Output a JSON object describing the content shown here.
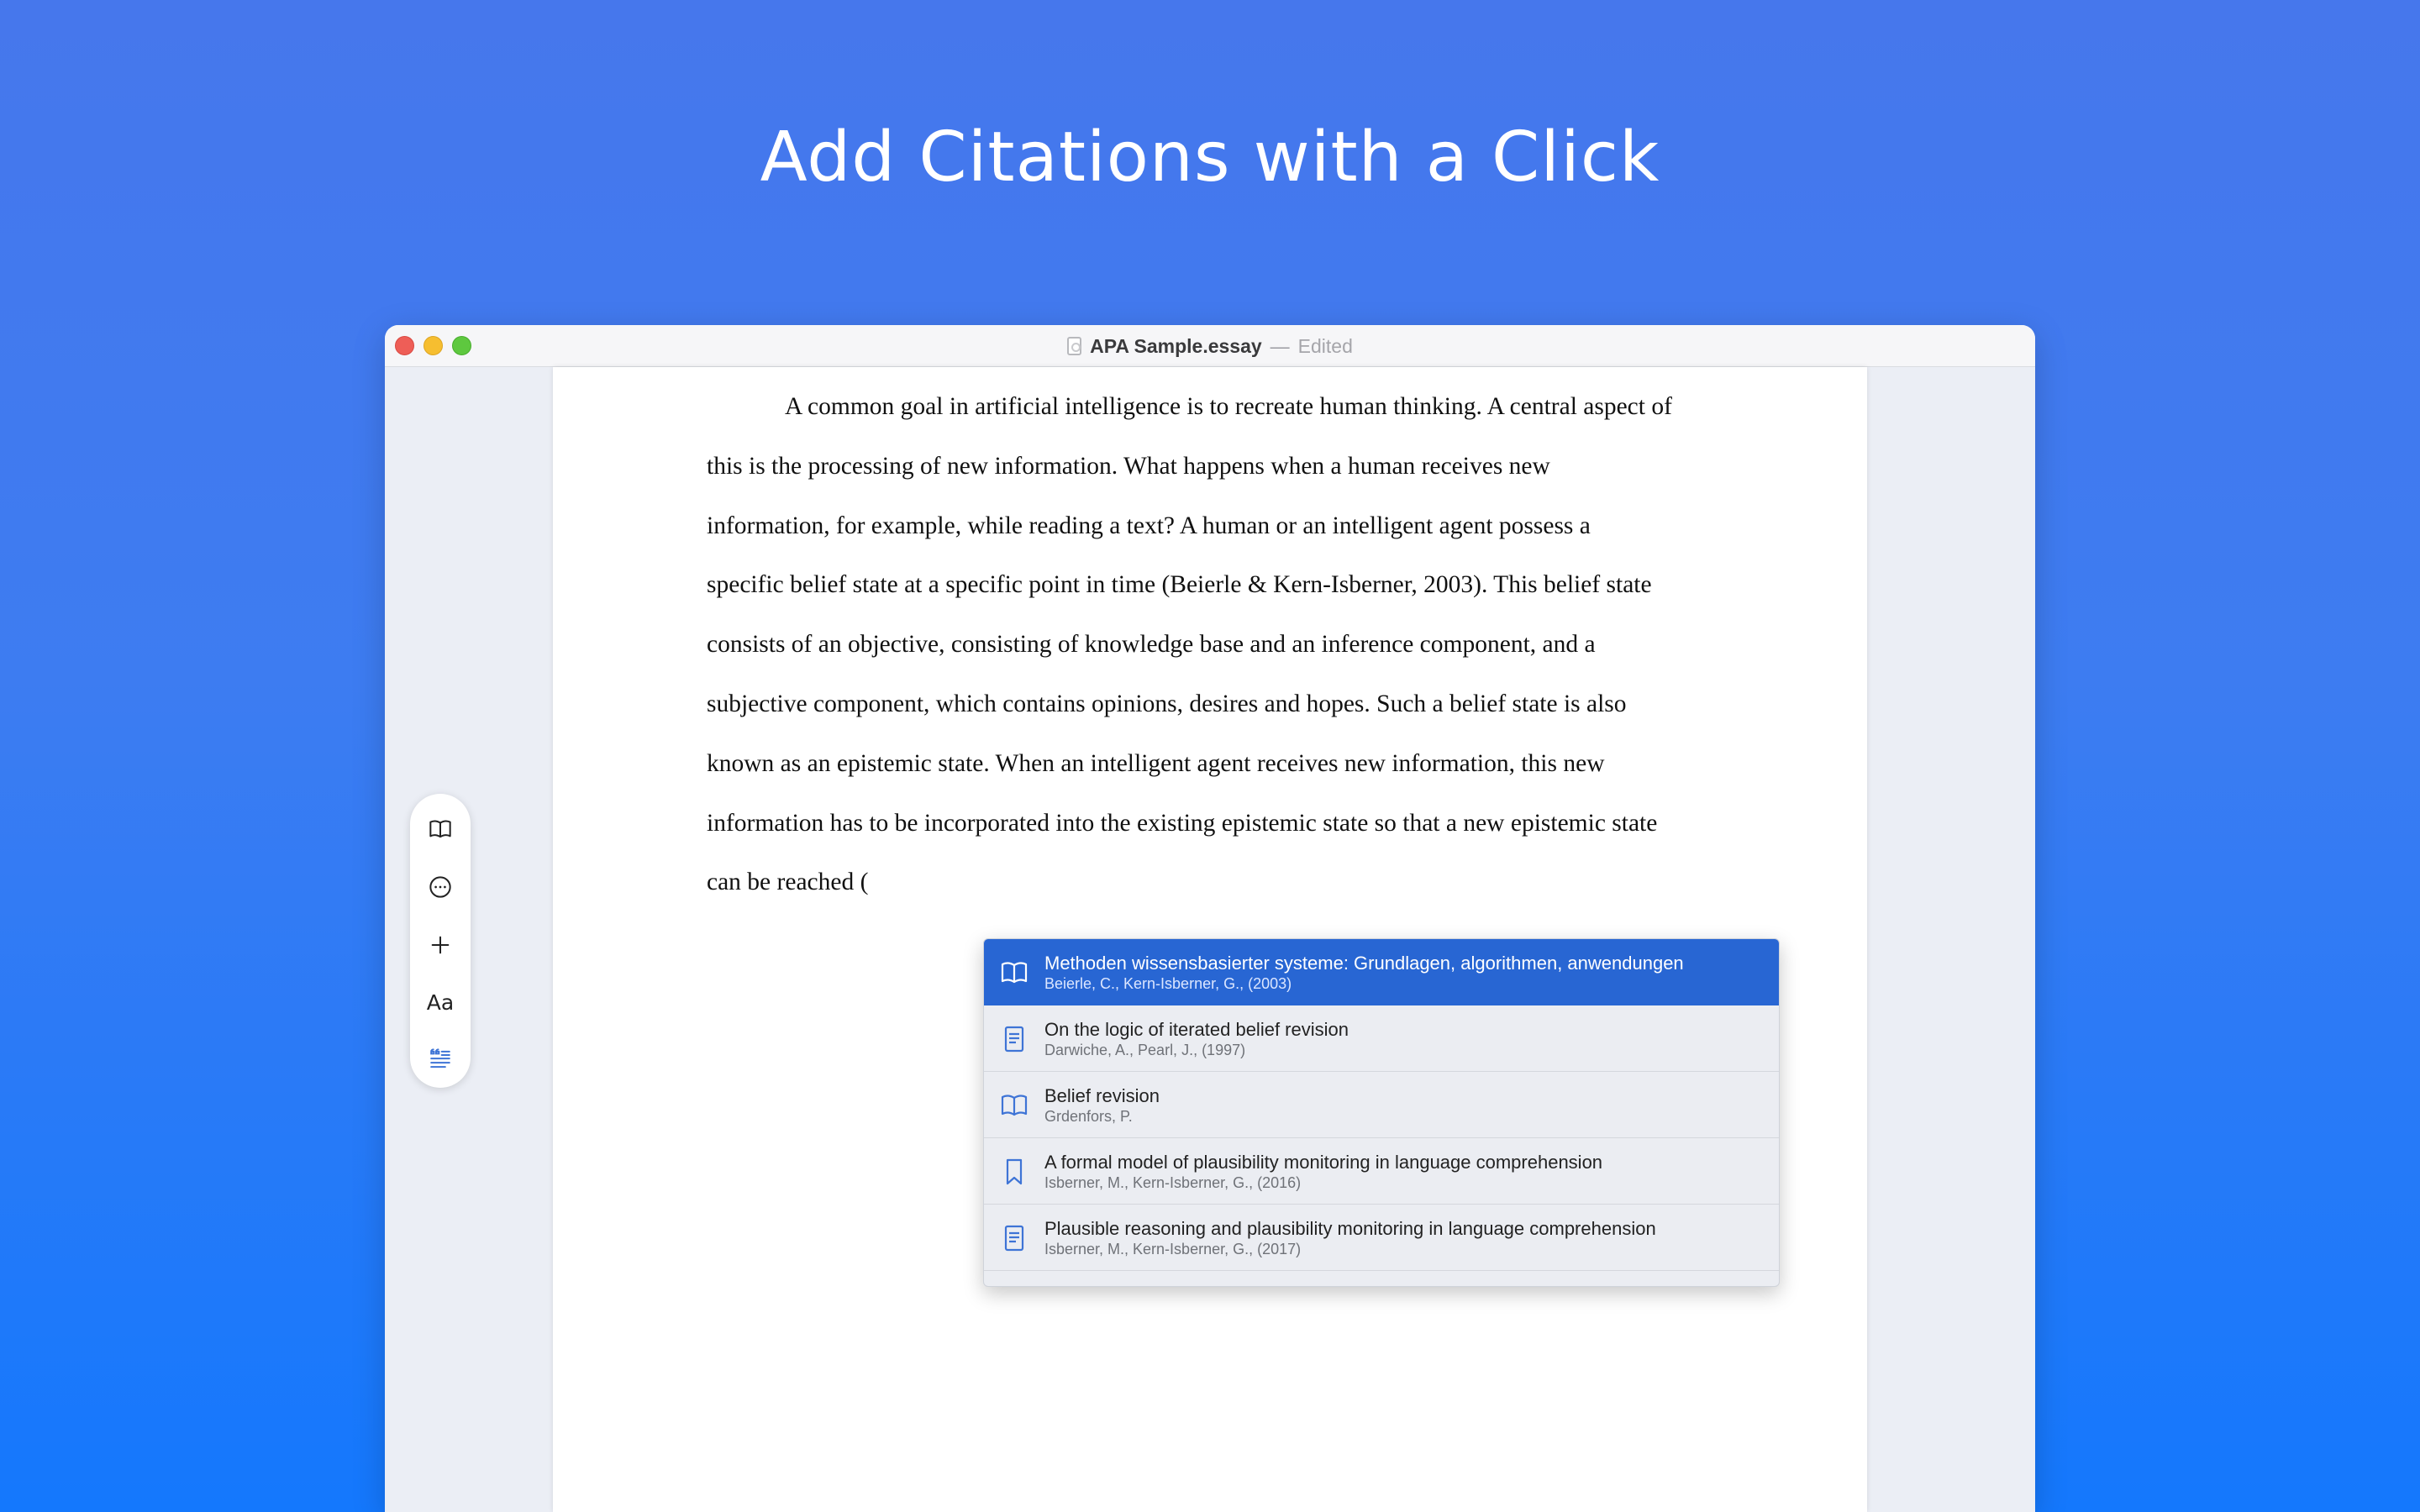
{
  "headline": "Add Citations with a Click",
  "window": {
    "title": "APA Sample.essay",
    "separator": "—",
    "status": "Edited"
  },
  "essay_lines": [
    "A common goal in artificial intelligence is to recreate human thinking. A central aspect of",
    "this is the processing of new information. What happens when a human receives new",
    "information, for example, while reading a text? A human or an intelligent agent possess a",
    "specific belief state at a specific point in time (Beierle & Kern-Isberner, 2003). This belief state",
    "consists of an objective, consisting of knowledge base and an inference component, and a",
    "subjective component, which contains opinions, desires and hopes. Such a belief state is also",
    "known as an epistemic state. When an intelligent agent receives new information, this new",
    "information has to be incorporated into the existing epistemic state so that a new epistemic state",
    "can be reached ("
  ],
  "toolbar": {
    "items": [
      {
        "icon": "book-icon"
      },
      {
        "icon": "more-circle-icon"
      },
      {
        "icon": "plus-icon"
      },
      {
        "icon": "font-icon",
        "label": "Aa"
      },
      {
        "icon": "citation-icon"
      }
    ]
  },
  "citations": [
    {
      "icon": "book-icon",
      "title": "Methoden wissensbasierter systeme: Grundlagen, algorithmen, anwendungen",
      "authors": "Beierle, C., Kern-Isberner, G., (2003)",
      "selected": true
    },
    {
      "icon": "document-icon",
      "title": "On the logic of iterated belief revision",
      "authors": "Darwiche, A., Pearl, J., (1997)",
      "selected": false
    },
    {
      "icon": "book-icon",
      "title": "Belief revision",
      "authors": "Grdenfors, P.",
      "selected": false
    },
    {
      "icon": "bookmark-icon",
      "title": "A formal model of plausibility monitoring in language comprehension",
      "authors": "Isberner, M., Kern-Isberner, G., (2016)",
      "selected": false
    },
    {
      "icon": "document-icon",
      "title": "Plausible reasoning and plausibility monitoring in language comprehension",
      "authors": "Isberner, M., Kern-Isberner, G., (2017)",
      "selected": false
    }
  ],
  "colors": {
    "accent": "#2866d3",
    "background_top": "#4677ec",
    "background_bottom": "#1478fd",
    "icon_blue": "#3e74d6"
  }
}
